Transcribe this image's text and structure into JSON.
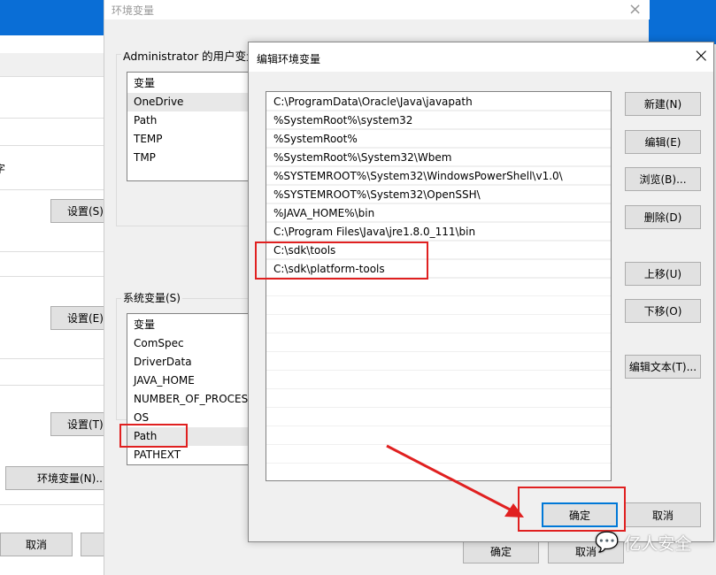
{
  "back_window": {
    "partial_text": "字",
    "buttons": [
      "设置(S)...",
      "设置(E)...",
      "设置(T)...",
      "环境变量(N)...",
      "取消"
    ]
  },
  "env_dialog": {
    "title": "环境变量",
    "user_group_label": "Administrator 的用户变量",
    "user_header": "变量",
    "user_vars": [
      "OneDrive",
      "Path",
      "TEMP",
      "TMP"
    ],
    "system_group_label": "系统变量(S)",
    "system_header": "变量",
    "system_vars": [
      "ComSpec",
      "DriverData",
      "JAVA_HOME",
      "NUMBER_OF_PROCESSORS",
      "OS",
      "Path",
      "PATHEXT"
    ],
    "ok": "确定",
    "cancel": "取消"
  },
  "edit_dialog": {
    "title": "编辑环境变量",
    "entries": [
      "C:\\ProgramData\\Oracle\\Java\\javapath",
      "%SystemRoot%\\system32",
      "%SystemRoot%",
      "%SystemRoot%\\System32\\Wbem",
      "%SYSTEMROOT%\\System32\\WindowsPowerShell\\v1.0\\",
      "%SYSTEMROOT%\\System32\\OpenSSH\\",
      "%JAVA_HOME%\\bin",
      "C:\\Program Files\\Java\\jre1.8.0_111\\bin",
      "C:\\sdk\\tools",
      "C:\\sdk\\platform-tools"
    ],
    "buttons": {
      "new": "新建(N)",
      "edit": "编辑(E)",
      "browse": "浏览(B)...",
      "delete": "删除(D)",
      "up": "上移(U)",
      "down": "下移(O)",
      "edit_text": "编辑文本(T)...",
      "ok": "确定",
      "cancel": "取消"
    }
  },
  "watermark": "亿人安全",
  "colors": {
    "annotation_red": "#e02020",
    "focus_blue": "#0078d7",
    "desktop_blue": "#0a6ed6"
  }
}
